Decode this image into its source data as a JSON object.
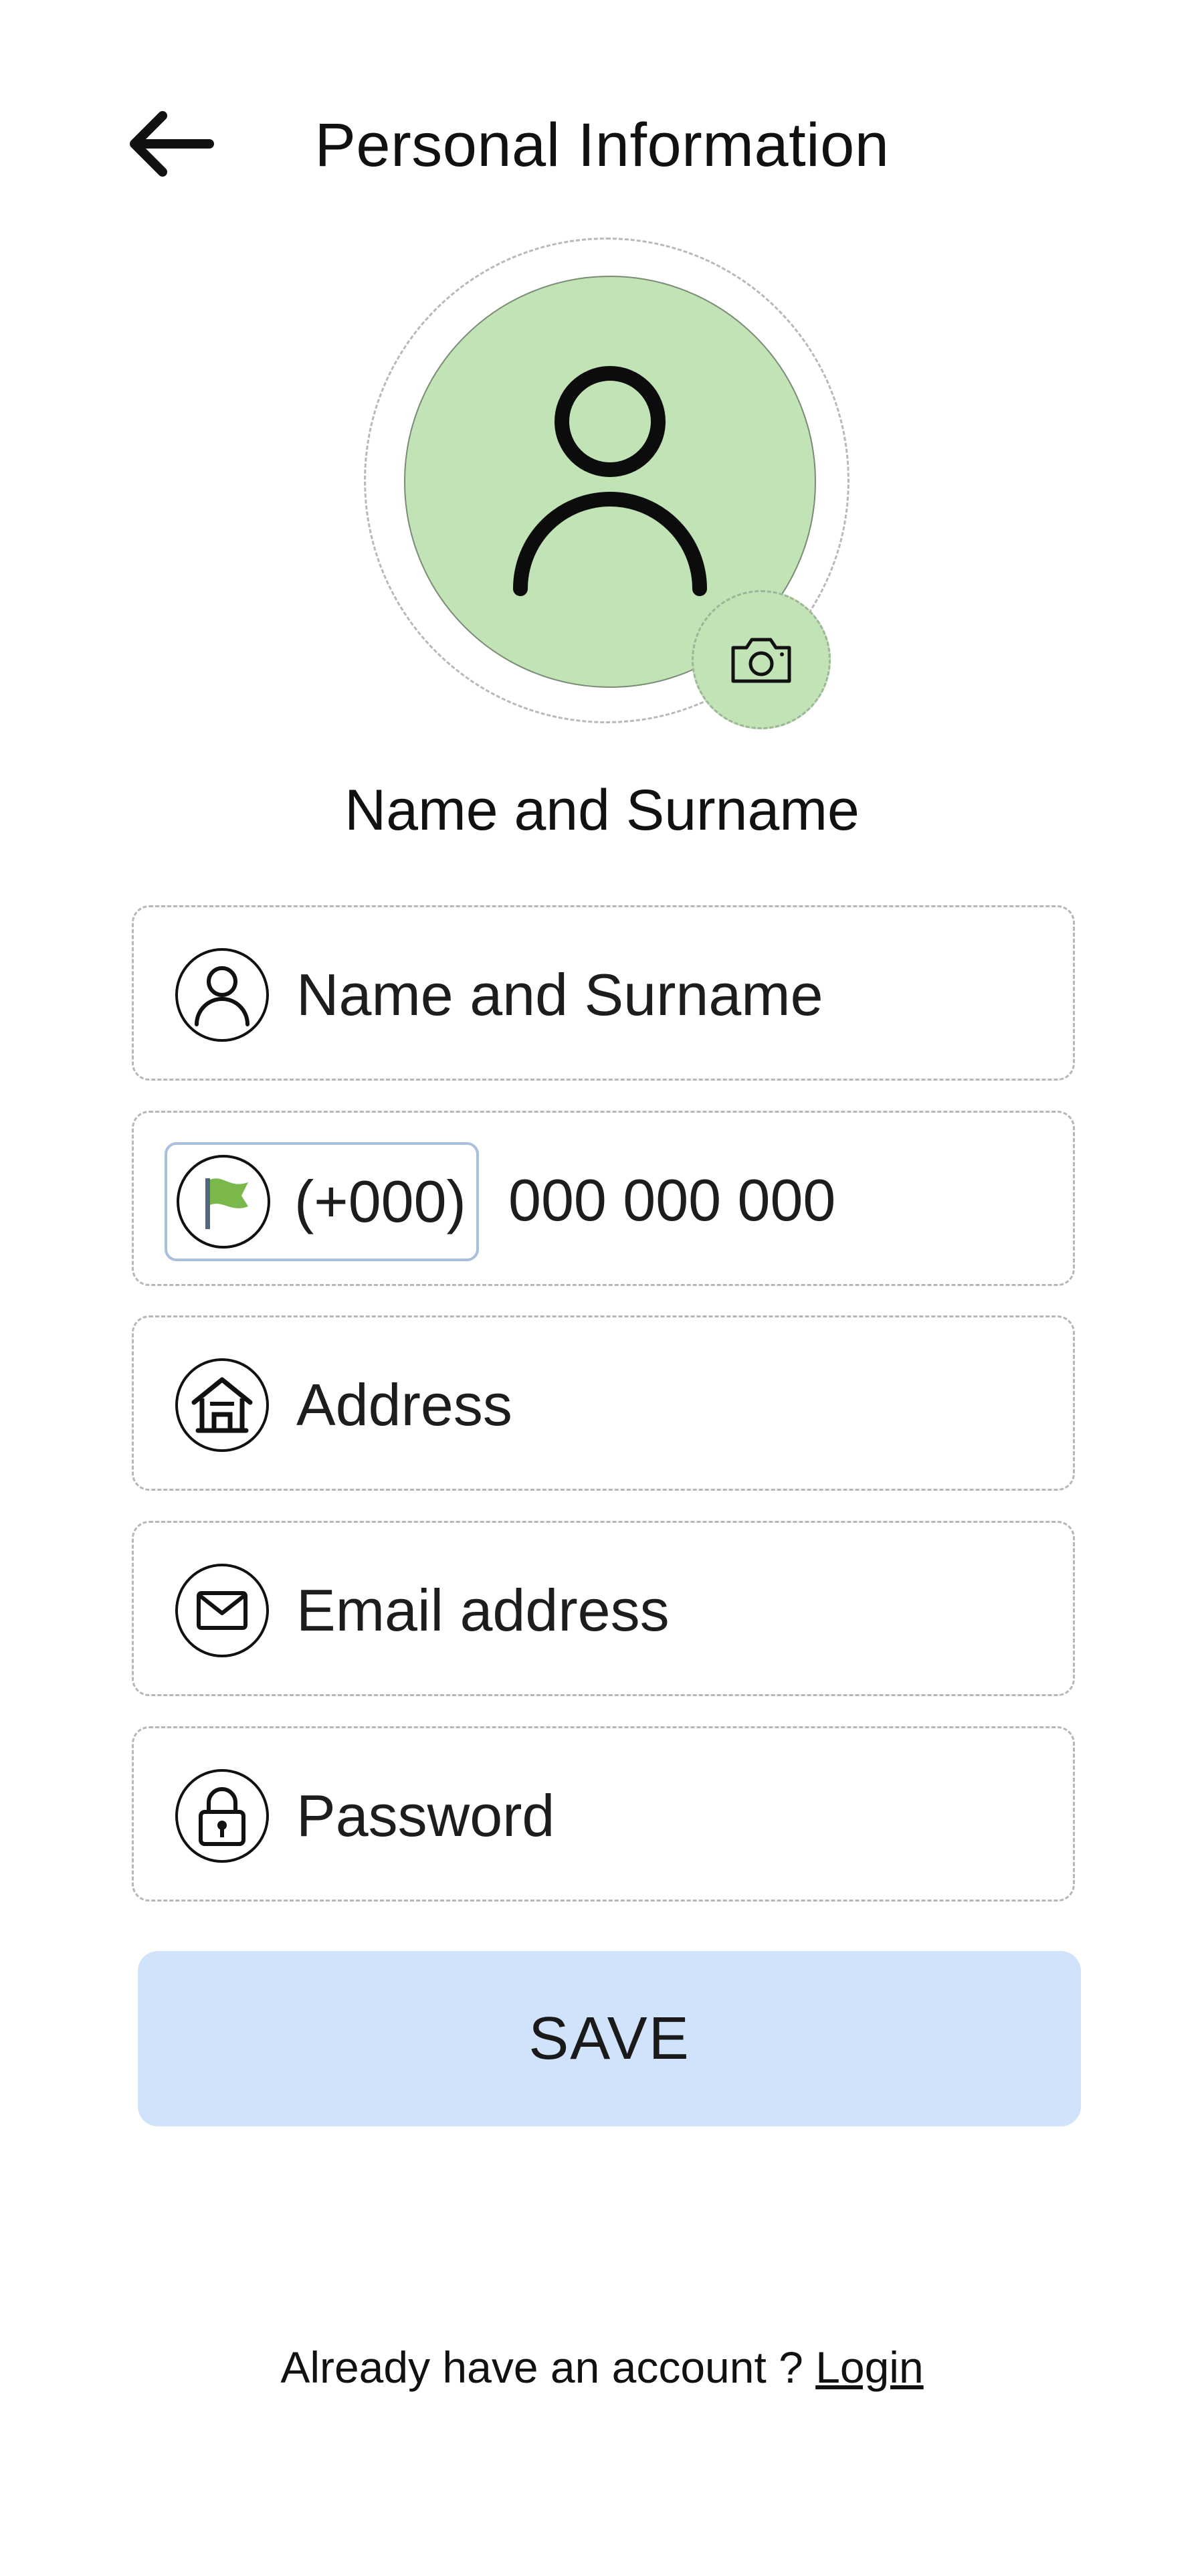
{
  "header": {
    "title": "Personal Information",
    "back_icon": "arrow-left-icon"
  },
  "profile": {
    "avatar_icon": "user-icon",
    "camera_icon": "camera-icon",
    "display_name": "Name and Surname",
    "avatar_bg_color": "#c1e3b6"
  },
  "form": {
    "name": {
      "placeholder": "Name and Surname",
      "icon": "user-circle-icon"
    },
    "phone": {
      "country_icon": "flag-icon",
      "country_code": "(+000)",
      "number_placeholder": "000 000 000"
    },
    "address": {
      "placeholder": "Address",
      "icon": "home-icon"
    },
    "email": {
      "placeholder": "Email address",
      "icon": "mail-icon"
    },
    "password": {
      "placeholder": "Password",
      "icon": "lock-icon"
    }
  },
  "actions": {
    "save_label": "SAVE",
    "save_color": "#d0e3fb"
  },
  "footer": {
    "prompt": "Already have an account ?",
    "login_label": "Login"
  }
}
